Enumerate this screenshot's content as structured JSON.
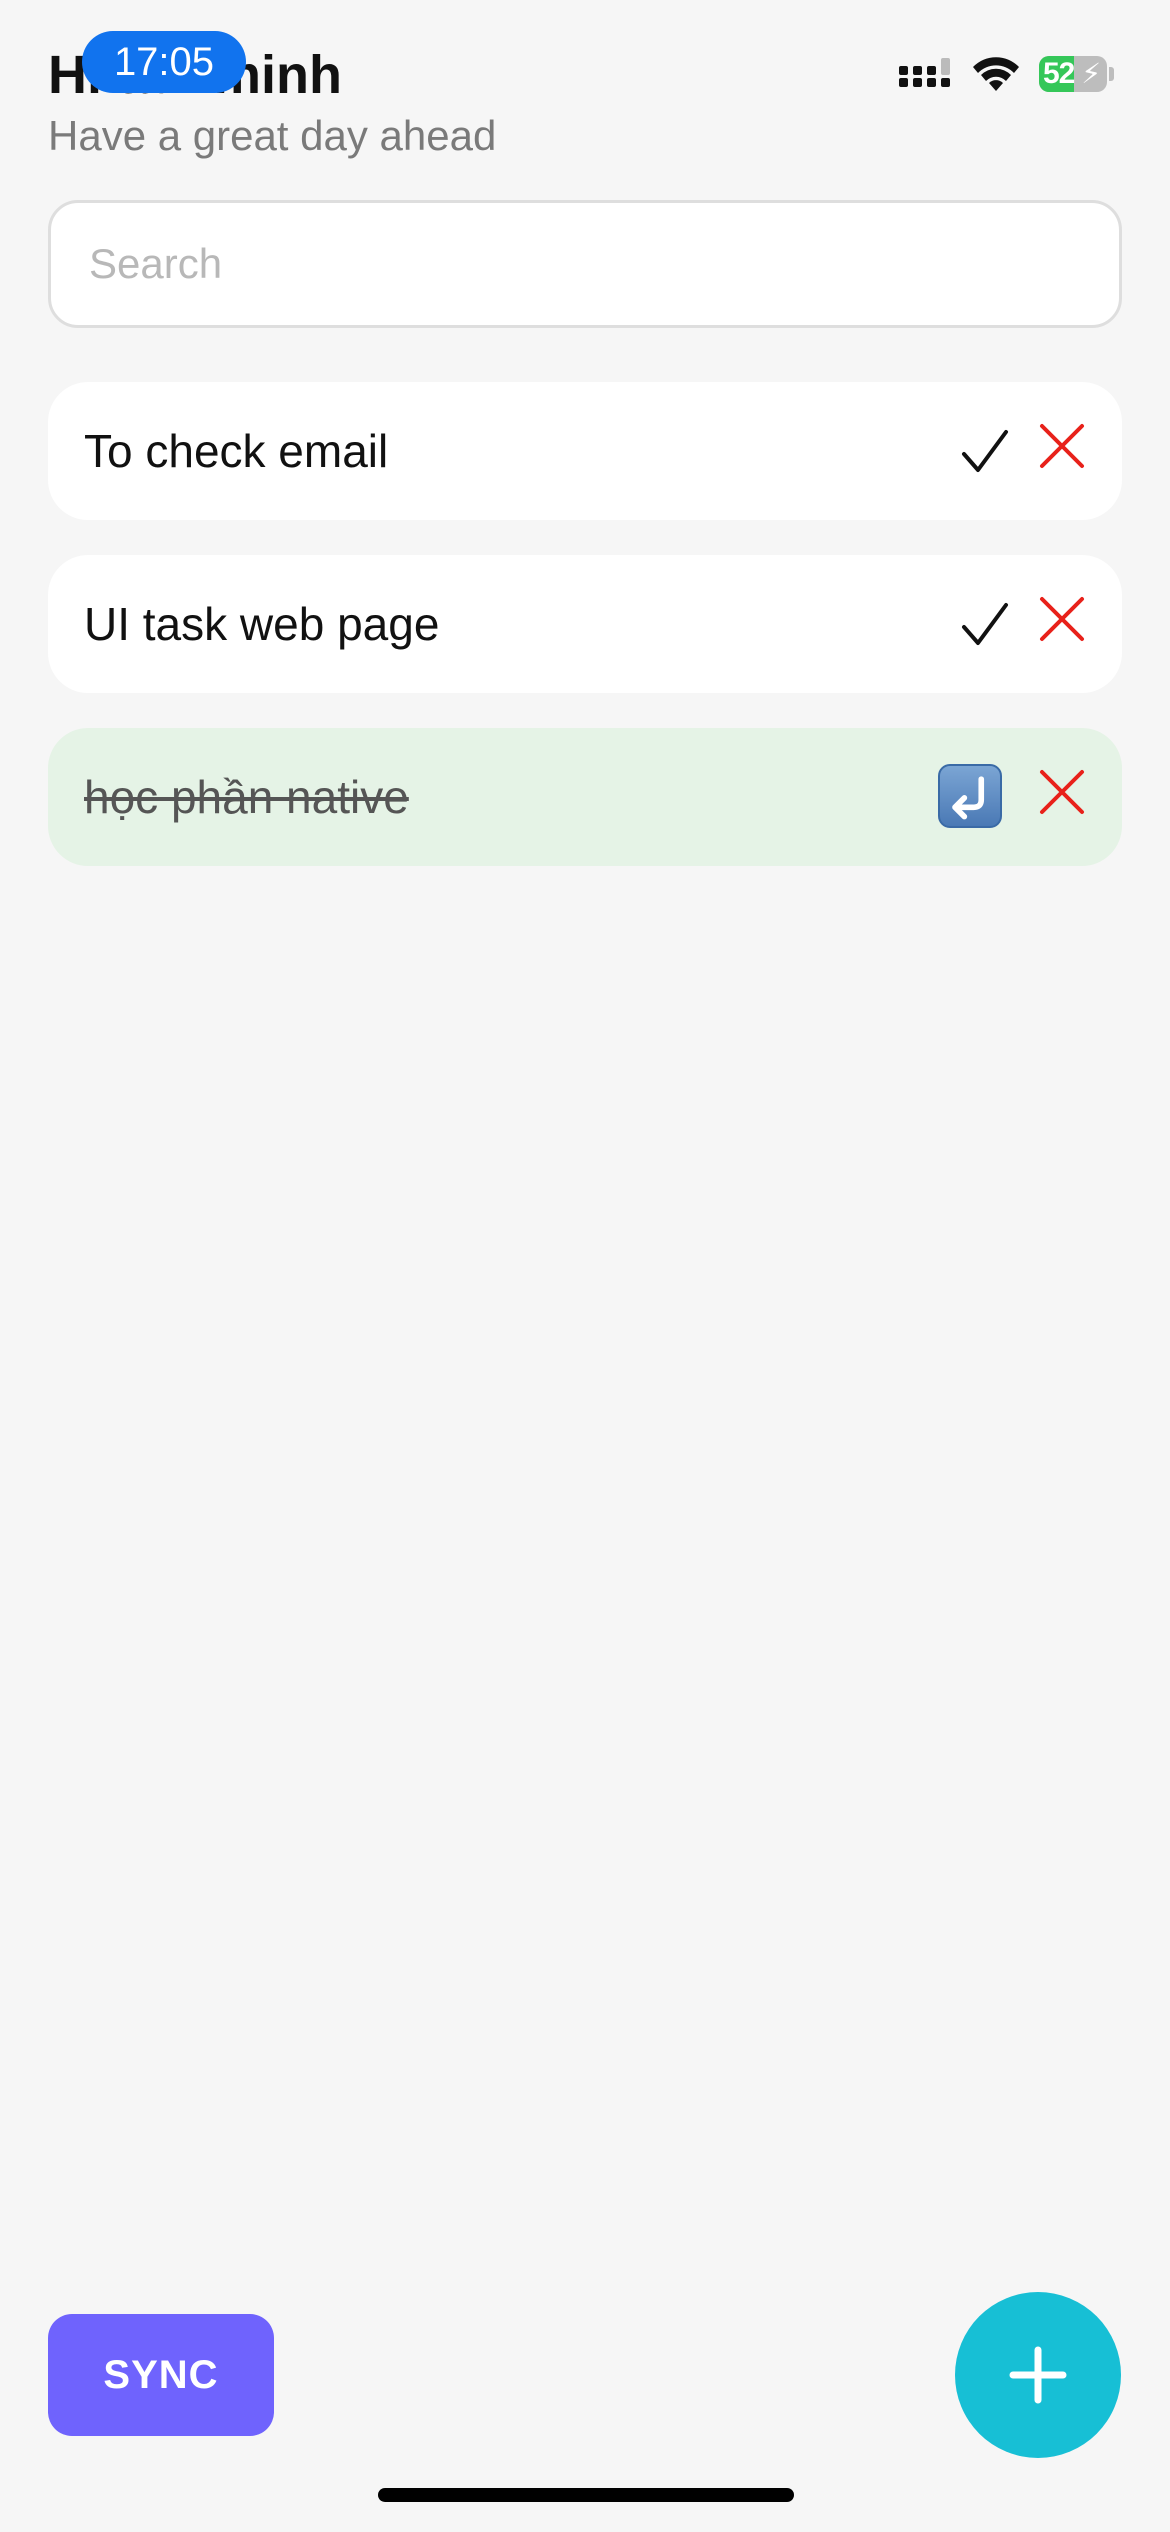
{
  "status_bar": {
    "time": "17:05",
    "battery_percent": "52",
    "battery_level": 0.52,
    "icons": [
      "signal-icon",
      "wifi-icon",
      "battery-charging-icon"
    ]
  },
  "header": {
    "greeting": "Hi tấn minh",
    "subtitle": "Have a great day ahead"
  },
  "search": {
    "placeholder": "Search",
    "value": ""
  },
  "tasks": [
    {
      "label": "To check email",
      "completed": false,
      "action_icon": "checkmark-icon"
    },
    {
      "label": "UI task web page",
      "completed": false,
      "action_icon": "checkmark-icon"
    },
    {
      "label": "học phần native",
      "completed": true,
      "action_icon": "undo-icon"
    }
  ],
  "footer": {
    "sync_label": "SYNC",
    "add_icon": "plus-icon"
  },
  "colors": {
    "background": "#f6f6f6",
    "time_pill": "#1173ee",
    "completed_row": "#e5f3e6",
    "delete": "#e8211a",
    "sync_button": "#6f63fd",
    "fab": "#17bfd5"
  }
}
